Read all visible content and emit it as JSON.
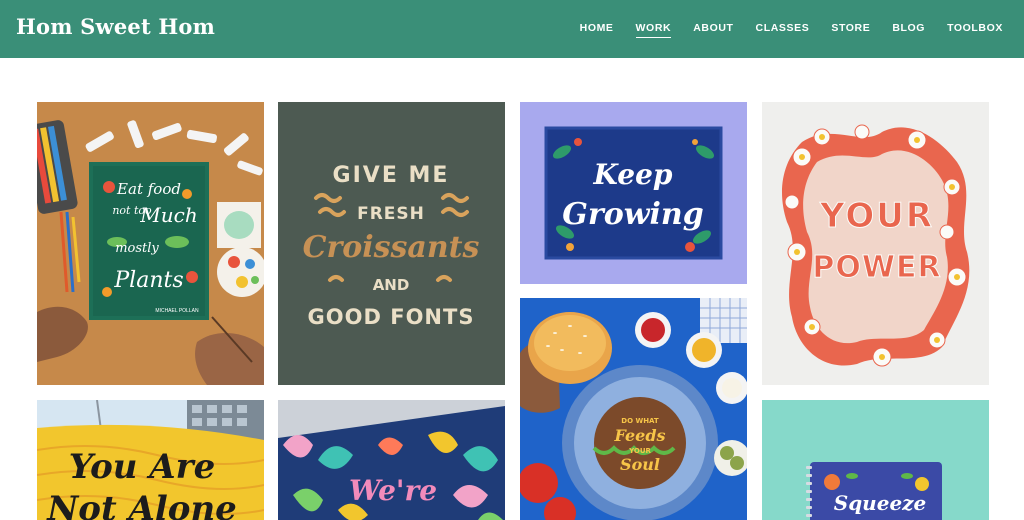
{
  "site": {
    "title": "Hom Sweet Hom"
  },
  "nav": {
    "items": [
      {
        "label": "HOME"
      },
      {
        "label": "WORK",
        "active": true
      },
      {
        "label": "ABOUT"
      },
      {
        "label": "CLASSES"
      },
      {
        "label": "STORE"
      },
      {
        "label": "BLOG"
      },
      {
        "label": "TOOLBOX"
      }
    ]
  },
  "portfolio": {
    "tiles": [
      {
        "lettering": [
          "Eat food",
          "not too",
          "Much",
          "mostly",
          "Plants"
        ],
        "credit": "MICHAEL POLLAN"
      },
      {
        "lettering": [
          "GIVE ME",
          "FRESH",
          "Croissants",
          "AND",
          "GOOD FONTS"
        ]
      },
      {
        "lettering": [
          "Keep",
          "Growing"
        ]
      },
      {
        "lettering": [
          "YOUR",
          "POWER"
        ]
      },
      {
        "lettering": [
          "You Are",
          "Not Alone"
        ]
      },
      {
        "lettering": [
          "DO WHAT",
          "Feeds",
          "YOUR",
          "Soul"
        ]
      },
      {
        "lettering": [
          "We're"
        ]
      },
      {
        "lettering": [
          "Squeeze"
        ]
      }
    ]
  },
  "colors": {
    "header_bg": "#3a8f78",
    "page_bg": "#ffffff"
  }
}
